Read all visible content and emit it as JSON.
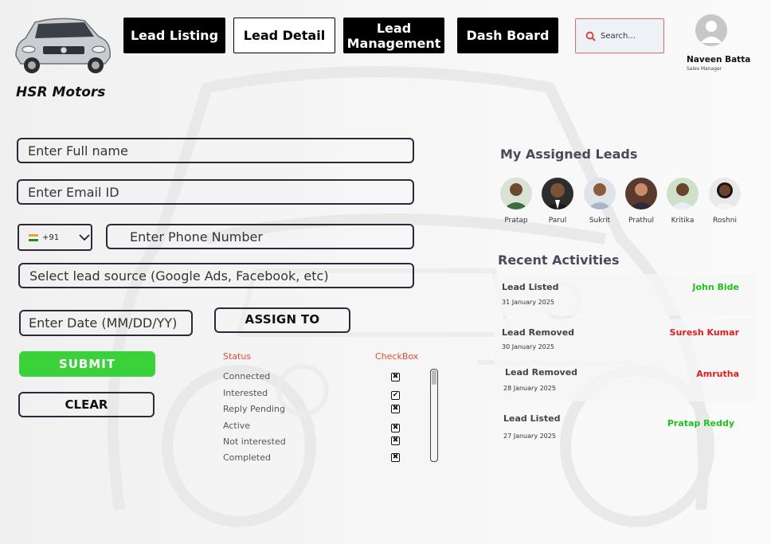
{
  "brand": {
    "name": "HSR Motors"
  },
  "nav": {
    "lead_listing": "Lead Listing",
    "lead_detail": "Lead Detail",
    "lead_management": "Lead Management",
    "dashboard": "Dash Board"
  },
  "search": {
    "placeholder": "Search..."
  },
  "user": {
    "name": "Naveen Batta",
    "role": "Sales Manager"
  },
  "form": {
    "full_name_placeholder": "Enter Full name",
    "email_placeholder": "Enter Email ID",
    "country_code": "+91",
    "phone_placeholder": "Enter Phone Number",
    "lead_source_placeholder": "Select lead source (Google Ads, Facebook, etc)",
    "date_placeholder": "Enter Date (MM/DD/YY)",
    "assign_label": "ASSIGN TO",
    "submit_label": "SUBMIT",
    "clear_label": "CLEAR"
  },
  "status_panel": {
    "status_header": "Status",
    "checkbox_header": "CheckBox",
    "items": [
      {
        "label": "Connected",
        "state": "x"
      },
      {
        "label": "Interested",
        "state": "check"
      },
      {
        "label": "Reply Pending",
        "state": "x"
      },
      {
        "label": "Active",
        "state": "x"
      },
      {
        "label": "Not interested",
        "state": "x"
      },
      {
        "label": "Completed",
        "state": "x"
      }
    ]
  },
  "assigned": {
    "title": "My Assigned Leads",
    "leads": [
      {
        "name": "Pratap"
      },
      {
        "name": "Parul"
      },
      {
        "name": "Sukrit"
      },
      {
        "name": "Prathul"
      },
      {
        "name": "Kritika"
      },
      {
        "name": "Roshni"
      }
    ]
  },
  "recent": {
    "title": "Recent Activities",
    "items": [
      {
        "action": "Lead Listed",
        "date": "31 January 2025",
        "person": "John Bide",
        "color": "#1ec21e"
      },
      {
        "action": "Lead Removed",
        "date": "30 January 2025",
        "person": "Suresh Kumar",
        "color": "#e31b1b"
      },
      {
        "action": "Lead Removed",
        "date": "28 January 2025",
        "person": "Amrutha",
        "color": "#e31b1b"
      },
      {
        "action": "Lead Listed",
        "date": "27 January 2025",
        "person": "Pratap Reddy",
        "color": "#1ec21e"
      }
    ]
  },
  "colors": {
    "accent_green": "#3bd13b",
    "red": "#e24a3a",
    "nav_black": "#000000"
  }
}
